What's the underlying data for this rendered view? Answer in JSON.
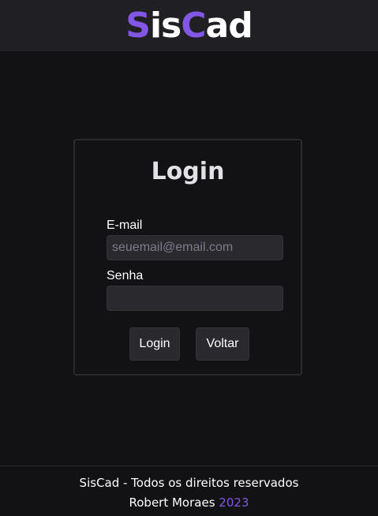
{
  "header": {
    "logo_part1": "S",
    "logo_part2": "is",
    "logo_part3": "C",
    "logo_part4": "ad",
    "accent_color": "#8257e5"
  },
  "login_card": {
    "title": "Login",
    "email_label": "E-mail",
    "email_placeholder": "seuemail@email.com",
    "email_value": "",
    "password_label": "Senha",
    "password_value": "",
    "login_button": "Login",
    "back_button": "Voltar"
  },
  "footer": {
    "line1": "SisCad - Todos os direitos reservados",
    "author": "Robert Moraes",
    "year": "2023"
  },
  "colors": {
    "background": "#121214",
    "header_background": "#202024",
    "input_background": "#29292e",
    "accent": "#8257e5"
  }
}
